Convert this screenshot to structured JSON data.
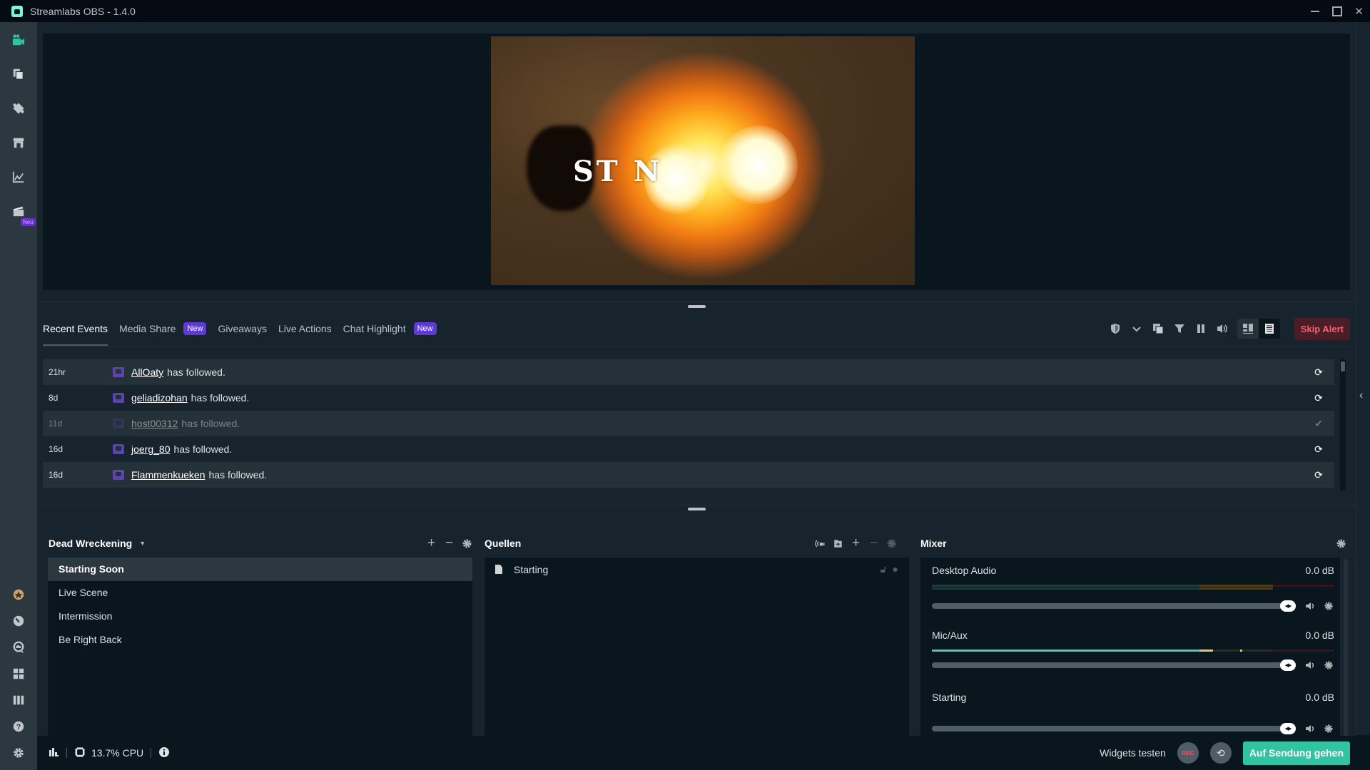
{
  "window": {
    "title": "Streamlabs OBS - 1.4.0",
    "controls": [
      "minimize",
      "maximize",
      "close"
    ]
  },
  "sidebar": {
    "top_items": [
      {
        "name": "editor",
        "icon": "studio-camera-icon",
        "active": true
      },
      {
        "name": "themes",
        "icon": "layers-icon"
      },
      {
        "name": "app-store",
        "icon": "puzzle-icon"
      },
      {
        "name": "store",
        "icon": "store-icon"
      },
      {
        "name": "dashboard",
        "icon": "chart-line-icon"
      },
      {
        "name": "highlighter",
        "icon": "clapperboard-icon",
        "badge": "Neu"
      }
    ],
    "bottom_items": [
      {
        "name": "prime",
        "icon": "prime-badge-icon"
      },
      {
        "name": "dashboard-gauge",
        "icon": "gauge-icon"
      },
      {
        "name": "chat",
        "icon": "chat-cloud-icon"
      },
      {
        "name": "layout",
        "icon": "grid-icon"
      },
      {
        "name": "studio-mode",
        "icon": "columns-icon"
      },
      {
        "name": "help",
        "icon": "help-icon"
      },
      {
        "name": "settings",
        "icon": "gear-icon"
      }
    ]
  },
  "preview": {
    "overlay_text": "ST          N"
  },
  "events_panel": {
    "tabs": [
      {
        "label": "Recent Events",
        "active": true
      },
      {
        "label": "Media Share",
        "badge": "New"
      },
      {
        "label": "Giveaways"
      },
      {
        "label": "Live Actions"
      },
      {
        "label": "Chat Highlight",
        "badge": "New"
      }
    ],
    "toolbar": {
      "icons": [
        "shield-icon",
        "chevron-down-icon",
        "popout-icon",
        "filter-icon",
        "pause-icon",
        "volume-icon"
      ],
      "view_toggle": [
        "compact-view-icon",
        "list-view-icon"
      ],
      "skip_alert_label": "Skip Alert"
    },
    "events": [
      {
        "time": "21hr",
        "user": "AllOaty",
        "action": "has followed.",
        "read": false
      },
      {
        "time": "8d",
        "user": "geliadizohan",
        "action": "has followed.",
        "read": false
      },
      {
        "time": "11d",
        "user": "host00312",
        "action": "has followed.",
        "read": true
      },
      {
        "time": "16d",
        "user": "joerg_80",
        "action": "has followed.",
        "read": false
      },
      {
        "time": "16d",
        "user": "Flammenkueken",
        "action": "has followed.",
        "read": false
      }
    ]
  },
  "scenes": {
    "collection": "Dead Wreckening",
    "items": [
      {
        "label": "Starting Soon",
        "active": true
      },
      {
        "label": "Live Scene"
      },
      {
        "label": "Intermission"
      },
      {
        "label": "Be Right Back"
      }
    ]
  },
  "sources": {
    "title": "Quellen",
    "items": [
      {
        "label": "Starting"
      }
    ]
  },
  "mixer": {
    "title": "Mixer",
    "sources": [
      {
        "name": "Desktop Audio",
        "db": "0.0 dB",
        "volume": 1.0,
        "level": 0.0
      },
      {
        "name": "Mic/Aux",
        "db": "0.0 dB",
        "volume": 1.0,
        "level": 0.7
      },
      {
        "name": "Starting",
        "db": "0.0 dB",
        "volume": 1.0,
        "level": 0.0
      }
    ]
  },
  "footer": {
    "cpu": "13.7% CPU",
    "widgets_label": "Widgets testen",
    "rec_label": "REC",
    "go_live_label": "Auf Sendung gehen"
  },
  "colors": {
    "accent": "#31c3a2",
    "badge_new": "#5e3bd3",
    "skip_alert": "#ff5c6c",
    "background": "#09161d",
    "panel": "#17242d"
  }
}
